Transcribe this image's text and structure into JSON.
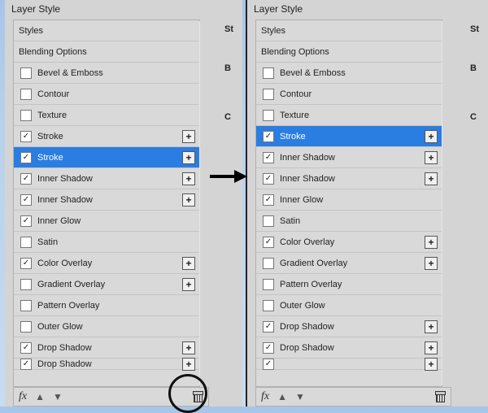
{
  "title": "Layer Style",
  "left": {
    "rows": [
      {
        "kind": "header",
        "label": "Styles"
      },
      {
        "kind": "header",
        "label": "Blending Options"
      },
      {
        "kind": "check",
        "checked": false,
        "label": "Bevel & Emboss"
      },
      {
        "kind": "subcheck",
        "checked": false,
        "label": "Contour"
      },
      {
        "kind": "subcheck",
        "checked": false,
        "label": "Texture"
      },
      {
        "kind": "check",
        "checked": true,
        "label": "Stroke",
        "plus": true
      },
      {
        "kind": "check",
        "checked": true,
        "label": "Stroke",
        "plus": true,
        "selected": true
      },
      {
        "kind": "check",
        "checked": true,
        "label": "Inner Shadow",
        "plus": true
      },
      {
        "kind": "check",
        "checked": true,
        "label": "Inner Shadow",
        "plus": true
      },
      {
        "kind": "check",
        "checked": true,
        "label": "Inner Glow"
      },
      {
        "kind": "check",
        "checked": false,
        "label": "Satin"
      },
      {
        "kind": "check",
        "checked": true,
        "label": "Color Overlay",
        "plus": true
      },
      {
        "kind": "check",
        "checked": false,
        "label": "Gradient Overlay",
        "plus": true
      },
      {
        "kind": "check",
        "checked": false,
        "label": "Pattern Overlay"
      },
      {
        "kind": "check",
        "checked": false,
        "label": "Outer Glow"
      },
      {
        "kind": "check",
        "checked": true,
        "label": "Drop Shadow",
        "plus": true
      },
      {
        "kind": "check",
        "checked": true,
        "label": "Drop Shadow",
        "plus": true,
        "cut": true
      }
    ],
    "side": [
      "St",
      " ",
      " ",
      "B",
      " ",
      " ",
      " ",
      "C"
    ]
  },
  "right": {
    "rows": [
      {
        "kind": "header",
        "label": "Styles"
      },
      {
        "kind": "header",
        "label": "Blending Options"
      },
      {
        "kind": "check",
        "checked": false,
        "label": "Bevel & Emboss"
      },
      {
        "kind": "subcheck",
        "checked": false,
        "label": "Contour"
      },
      {
        "kind": "subcheck",
        "checked": false,
        "label": "Texture"
      },
      {
        "kind": "check",
        "checked": true,
        "label": "Stroke",
        "plus": true,
        "selected": true
      },
      {
        "kind": "check",
        "checked": true,
        "label": "Inner Shadow",
        "plus": true
      },
      {
        "kind": "check",
        "checked": true,
        "label": "Inner Shadow",
        "plus": true
      },
      {
        "kind": "check",
        "checked": true,
        "label": "Inner Glow"
      },
      {
        "kind": "check",
        "checked": false,
        "label": "Satin"
      },
      {
        "kind": "check",
        "checked": true,
        "label": "Color Overlay",
        "plus": true
      },
      {
        "kind": "check",
        "checked": false,
        "label": "Gradient Overlay",
        "plus": true
      },
      {
        "kind": "check",
        "checked": false,
        "label": "Pattern Overlay"
      },
      {
        "kind": "check",
        "checked": false,
        "label": "Outer Glow"
      },
      {
        "kind": "check",
        "checked": true,
        "label": "Drop Shadow",
        "plus": true
      },
      {
        "kind": "check",
        "checked": true,
        "label": "Drop Shadow",
        "plus": true
      },
      {
        "kind": "check",
        "checked": true,
        "label": "",
        "plus": true,
        "cut": true
      }
    ],
    "side": [
      "St",
      " ",
      " ",
      "B",
      " ",
      " ",
      " ",
      "C"
    ]
  },
  "footer": {
    "fx": "fx"
  }
}
